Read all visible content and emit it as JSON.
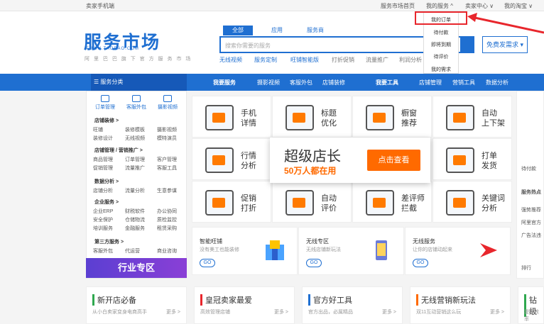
{
  "topbar": {
    "left": "卖家手机端",
    "links": [
      "服务市场首页",
      "我的服务",
      "卖家中心",
      "我的淘宝"
    ]
  },
  "logo": {
    "cn": "服务市场",
    "en": "FUWU.TAOBAO.COM",
    "sub": "阿 里 巴 巴 旗 下 官 方 服 务 市 场"
  },
  "search": {
    "tabs": [
      "全部",
      "应用",
      "服务商"
    ],
    "placeholder": "搜索你需要的服务",
    "hot": [
      "无线视频",
      "服务定制",
      "旺铺智能版",
      "打折促销",
      "流量推广",
      "利润分析"
    ],
    "post": "免费发需求 ▾"
  },
  "dropdown": [
    "我的订单",
    "待付款",
    "即将到期",
    "待评价",
    "我的需求"
  ],
  "nav": {
    "cat": "☰ 服务分类",
    "my_service": "我要服务",
    "services": [
      "摄影视频",
      "客服外包",
      "店铺装修"
    ],
    "my_tools": "我要工具",
    "tools": [
      "店铺管理",
      "营销工具",
      "数据分析"
    ]
  },
  "quick": [
    "订单管理",
    "客服外包",
    "摄影视频"
  ],
  "left": [
    {
      "h": "店铺装修 >",
      "items": [
        "旺铺",
        "装修模板",
        "摄影视频",
        "装修设计",
        "无线视频",
        "模特演员"
      ]
    },
    {
      "h": "店铺管理 / 营销推广 >",
      "items": [
        "商品管理",
        "订单管理",
        "客户管理",
        "促销管理",
        "流量推广",
        "客服工具"
      ]
    },
    {
      "h": "数据分析 >",
      "items": [
        "店铺分析",
        "流量分析",
        "生意参谋"
      ]
    },
    {
      "h": "企业服务 >",
      "items": [
        "企业ERP",
        "财税软件",
        "办公协同",
        "安全保护",
        "仓储物流",
        "质检监控",
        "培训服务",
        "金融服务",
        "租赁采购"
      ]
    },
    {
      "h": "第三方服务 >",
      "items": [
        "客服外包",
        "代运营",
        "商业咨询"
      ]
    }
  ],
  "zone": "行业专区",
  "grid": [
    "手机\n详情",
    "标题\n优化",
    "橱窗\n推荐",
    "自动\n上下架",
    "行情\n分析",
    "",
    "",
    "打单\n发货",
    "促销\n打折",
    "自动\n评价",
    "差评师\n拦截",
    "关键词\n分析"
  ],
  "banner": {
    "t1": "超级店长",
    "t2": "50万人都在用",
    "btn": "点击查看"
  },
  "cards": [
    {
      "t": "智能旺铺",
      "s": "没有美工也能装修",
      "go": "GO"
    },
    {
      "t": "无线专区",
      "s": "无线店铺新玩法",
      "go": "GO"
    },
    {
      "t": "无线服务",
      "s": "让你的店铺动起来",
      "go": "GO"
    }
  ],
  "right": [
    "待付款",
    "服务热点",
    "强势推荐",
    "阿里官方",
    "广告法违",
    "排行"
  ],
  "bottom": [
    {
      "t": "新开店必备",
      "s": "从小白卖家变身电商高手",
      "m": "更多 >",
      "c": "#2fa84f"
    },
    {
      "t": "皇冠卖家最爱",
      "s": "高效管理店铺",
      "m": "更多 >",
      "c": "#e8262c"
    },
    {
      "t": "官方好工具",
      "s": "官方出品，必属精品",
      "m": "更多 >",
      "c": "#1f6fd1"
    },
    {
      "t": "无线营销新玩法",
      "s": "双11互动营销这么玩",
      "m": "更多 >",
      "c": "#ff6a00"
    },
    {
      "t": "钻级",
      "s": "提升效率",
      "m": "",
      "c": "#2fa84f"
    }
  ]
}
